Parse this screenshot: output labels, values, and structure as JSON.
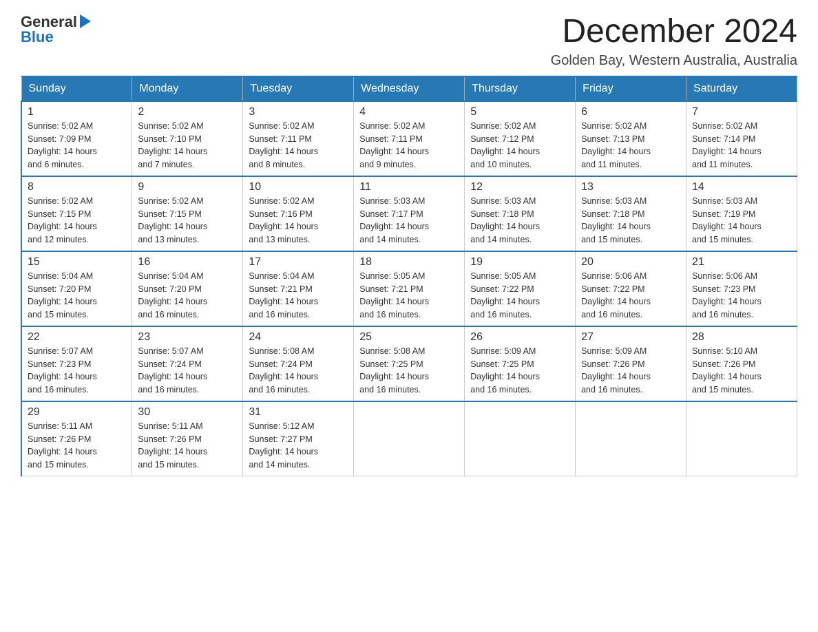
{
  "header": {
    "logo_general": "General",
    "logo_blue": "Blue",
    "month_title": "December 2024",
    "location": "Golden Bay, Western Australia, Australia"
  },
  "days_of_week": [
    "Sunday",
    "Monday",
    "Tuesday",
    "Wednesday",
    "Thursday",
    "Friday",
    "Saturday"
  ],
  "weeks": [
    [
      {
        "day": "1",
        "sunrise": "5:02 AM",
        "sunset": "7:09 PM",
        "daylight": "14 hours and 6 minutes."
      },
      {
        "day": "2",
        "sunrise": "5:02 AM",
        "sunset": "7:10 PM",
        "daylight": "14 hours and 7 minutes."
      },
      {
        "day": "3",
        "sunrise": "5:02 AM",
        "sunset": "7:11 PM",
        "daylight": "14 hours and 8 minutes."
      },
      {
        "day": "4",
        "sunrise": "5:02 AM",
        "sunset": "7:11 PM",
        "daylight": "14 hours and 9 minutes."
      },
      {
        "day": "5",
        "sunrise": "5:02 AM",
        "sunset": "7:12 PM",
        "daylight": "14 hours and 10 minutes."
      },
      {
        "day": "6",
        "sunrise": "5:02 AM",
        "sunset": "7:13 PM",
        "daylight": "14 hours and 11 minutes."
      },
      {
        "day": "7",
        "sunrise": "5:02 AM",
        "sunset": "7:14 PM",
        "daylight": "14 hours and 11 minutes."
      }
    ],
    [
      {
        "day": "8",
        "sunrise": "5:02 AM",
        "sunset": "7:15 PM",
        "daylight": "14 hours and 12 minutes."
      },
      {
        "day": "9",
        "sunrise": "5:02 AM",
        "sunset": "7:15 PM",
        "daylight": "14 hours and 13 minutes."
      },
      {
        "day": "10",
        "sunrise": "5:02 AM",
        "sunset": "7:16 PM",
        "daylight": "14 hours and 13 minutes."
      },
      {
        "day": "11",
        "sunrise": "5:03 AM",
        "sunset": "7:17 PM",
        "daylight": "14 hours and 14 minutes."
      },
      {
        "day": "12",
        "sunrise": "5:03 AM",
        "sunset": "7:18 PM",
        "daylight": "14 hours and 14 minutes."
      },
      {
        "day": "13",
        "sunrise": "5:03 AM",
        "sunset": "7:18 PM",
        "daylight": "14 hours and 15 minutes."
      },
      {
        "day": "14",
        "sunrise": "5:03 AM",
        "sunset": "7:19 PM",
        "daylight": "14 hours and 15 minutes."
      }
    ],
    [
      {
        "day": "15",
        "sunrise": "5:04 AM",
        "sunset": "7:20 PM",
        "daylight": "14 hours and 15 minutes."
      },
      {
        "day": "16",
        "sunrise": "5:04 AM",
        "sunset": "7:20 PM",
        "daylight": "14 hours and 16 minutes."
      },
      {
        "day": "17",
        "sunrise": "5:04 AM",
        "sunset": "7:21 PM",
        "daylight": "14 hours and 16 minutes."
      },
      {
        "day": "18",
        "sunrise": "5:05 AM",
        "sunset": "7:21 PM",
        "daylight": "14 hours and 16 minutes."
      },
      {
        "day": "19",
        "sunrise": "5:05 AM",
        "sunset": "7:22 PM",
        "daylight": "14 hours and 16 minutes."
      },
      {
        "day": "20",
        "sunrise": "5:06 AM",
        "sunset": "7:22 PM",
        "daylight": "14 hours and 16 minutes."
      },
      {
        "day": "21",
        "sunrise": "5:06 AM",
        "sunset": "7:23 PM",
        "daylight": "14 hours and 16 minutes."
      }
    ],
    [
      {
        "day": "22",
        "sunrise": "5:07 AM",
        "sunset": "7:23 PM",
        "daylight": "14 hours and 16 minutes."
      },
      {
        "day": "23",
        "sunrise": "5:07 AM",
        "sunset": "7:24 PM",
        "daylight": "14 hours and 16 minutes."
      },
      {
        "day": "24",
        "sunrise": "5:08 AM",
        "sunset": "7:24 PM",
        "daylight": "14 hours and 16 minutes."
      },
      {
        "day": "25",
        "sunrise": "5:08 AM",
        "sunset": "7:25 PM",
        "daylight": "14 hours and 16 minutes."
      },
      {
        "day": "26",
        "sunrise": "5:09 AM",
        "sunset": "7:25 PM",
        "daylight": "14 hours and 16 minutes."
      },
      {
        "day": "27",
        "sunrise": "5:09 AM",
        "sunset": "7:26 PM",
        "daylight": "14 hours and 16 minutes."
      },
      {
        "day": "28",
        "sunrise": "5:10 AM",
        "sunset": "7:26 PM",
        "daylight": "14 hours and 15 minutes."
      }
    ],
    [
      {
        "day": "29",
        "sunrise": "5:11 AM",
        "sunset": "7:26 PM",
        "daylight": "14 hours and 15 minutes."
      },
      {
        "day": "30",
        "sunrise": "5:11 AM",
        "sunset": "7:26 PM",
        "daylight": "14 hours and 15 minutes."
      },
      {
        "day": "31",
        "sunrise": "5:12 AM",
        "sunset": "7:27 PM",
        "daylight": "14 hours and 14 minutes."
      },
      null,
      null,
      null,
      null
    ]
  ],
  "labels": {
    "sunrise": "Sunrise:",
    "sunset": "Sunset:",
    "daylight": "Daylight:"
  }
}
